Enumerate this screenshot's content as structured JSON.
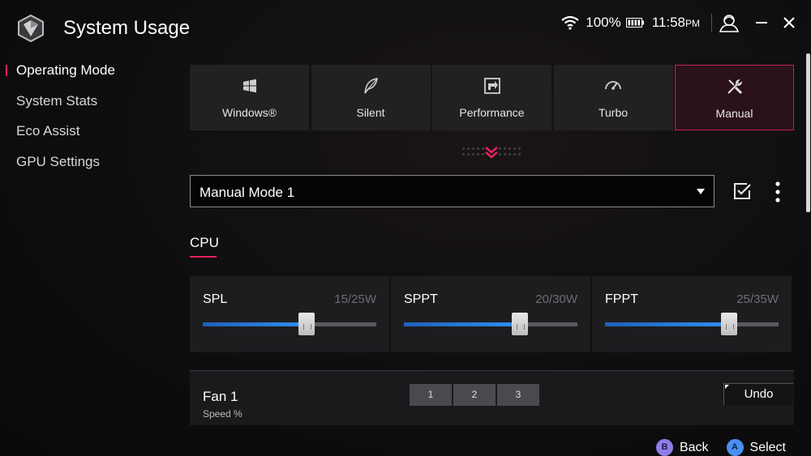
{
  "header": {
    "title": "System Usage",
    "battery_percent": "100%",
    "time": "11:58",
    "time_suffix": "PM"
  },
  "sidebar": {
    "items": [
      {
        "label": "Operating Mode",
        "active": true
      },
      {
        "label": "System Stats",
        "active": false
      },
      {
        "label": "Eco Assist",
        "active": false
      },
      {
        "label": "GPU Settings",
        "active": false
      }
    ]
  },
  "modes": [
    {
      "label": "Windows®",
      "icon": "windows-icon"
    },
    {
      "label": "Silent",
      "icon": "feather-icon"
    },
    {
      "label": "Performance",
      "icon": "performance-icon"
    },
    {
      "label": "Turbo",
      "icon": "speedometer-icon"
    },
    {
      "label": "Manual",
      "icon": "tools-icon",
      "active": true
    }
  ],
  "profile": {
    "selected": "Manual Mode 1"
  },
  "cpu": {
    "tab_label": "CPU",
    "sliders": [
      {
        "name": "SPL",
        "value_text": "15/25W",
        "value": 15,
        "max": 25
      },
      {
        "name": "SPPT",
        "value_text": "20/30W",
        "value": 20,
        "max": 30
      },
      {
        "name": "FPPT",
        "value_text": "25/35W",
        "value": 25,
        "max": 35
      }
    ]
  },
  "fan": {
    "name": "Fan 1",
    "subtitle": "Speed %",
    "tabs": [
      "1",
      "2",
      "3"
    ],
    "undo_label": "Undo"
  },
  "hints": {
    "back_button": "B",
    "back_label": "Back",
    "select_button": "A",
    "select_label": "Select"
  },
  "colors": {
    "accent": "#e8245a",
    "slider_fill": "#2f8ff0"
  }
}
